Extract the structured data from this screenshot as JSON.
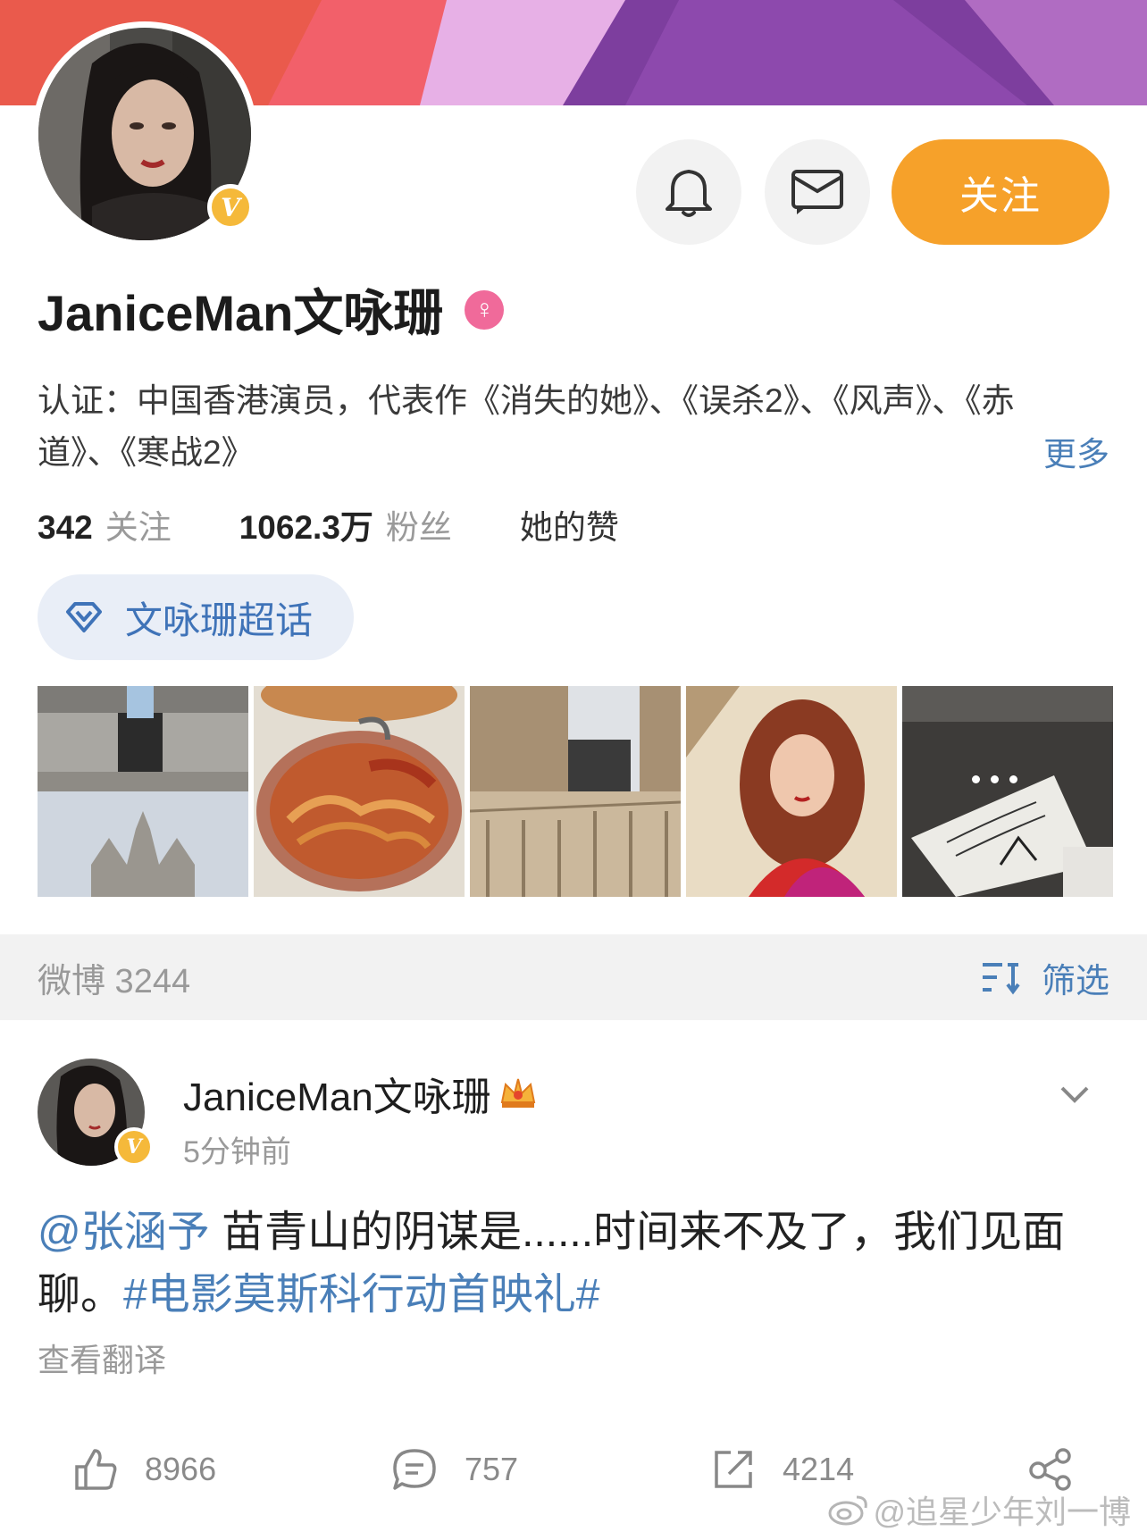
{
  "profile": {
    "name": "JaniceMan文咏珊",
    "verify_text": "认证：中国香港演员，代表作《消失的她》、《误杀2》、《风声》、《赤道》、《寒战2》",
    "more_label": "更多",
    "follow_label": "关注",
    "verified_badge": "V",
    "gender_icon": "female-icon",
    "stats": {
      "following_count": "342",
      "following_label": "关注",
      "fans_count": "1062.3万",
      "fans_label": "粉丝",
      "likes_label": "她的赞"
    },
    "supertopic_label": "文咏珊超话"
  },
  "photos": [
    "milan-square-cathedral",
    "lobster-pasta",
    "galleria-milan",
    "red-portrait",
    "fendi-welcome-card"
  ],
  "section": {
    "weibo_label": "微博 3244",
    "filter_label": "筛选"
  },
  "post": {
    "author": "JaniceMan文咏珊",
    "time": "5分钟前",
    "mention": "@张涵予",
    "text_main": " 苗青山的阴谋是......时间来不及了，我们见面聊。",
    "hashtag": "#电影莫斯科行动首映礼#",
    "translate_label": "查看翻译",
    "likes": "8966",
    "comments": "757",
    "reposts": "4214"
  },
  "watermark": "@追星少年刘一博",
  "colors": {
    "accent_orange": "#f6a12a",
    "link_blue": "#4a7fb8",
    "verified_gold": "#f5b93a",
    "gender_pink": "#f06a9a"
  }
}
